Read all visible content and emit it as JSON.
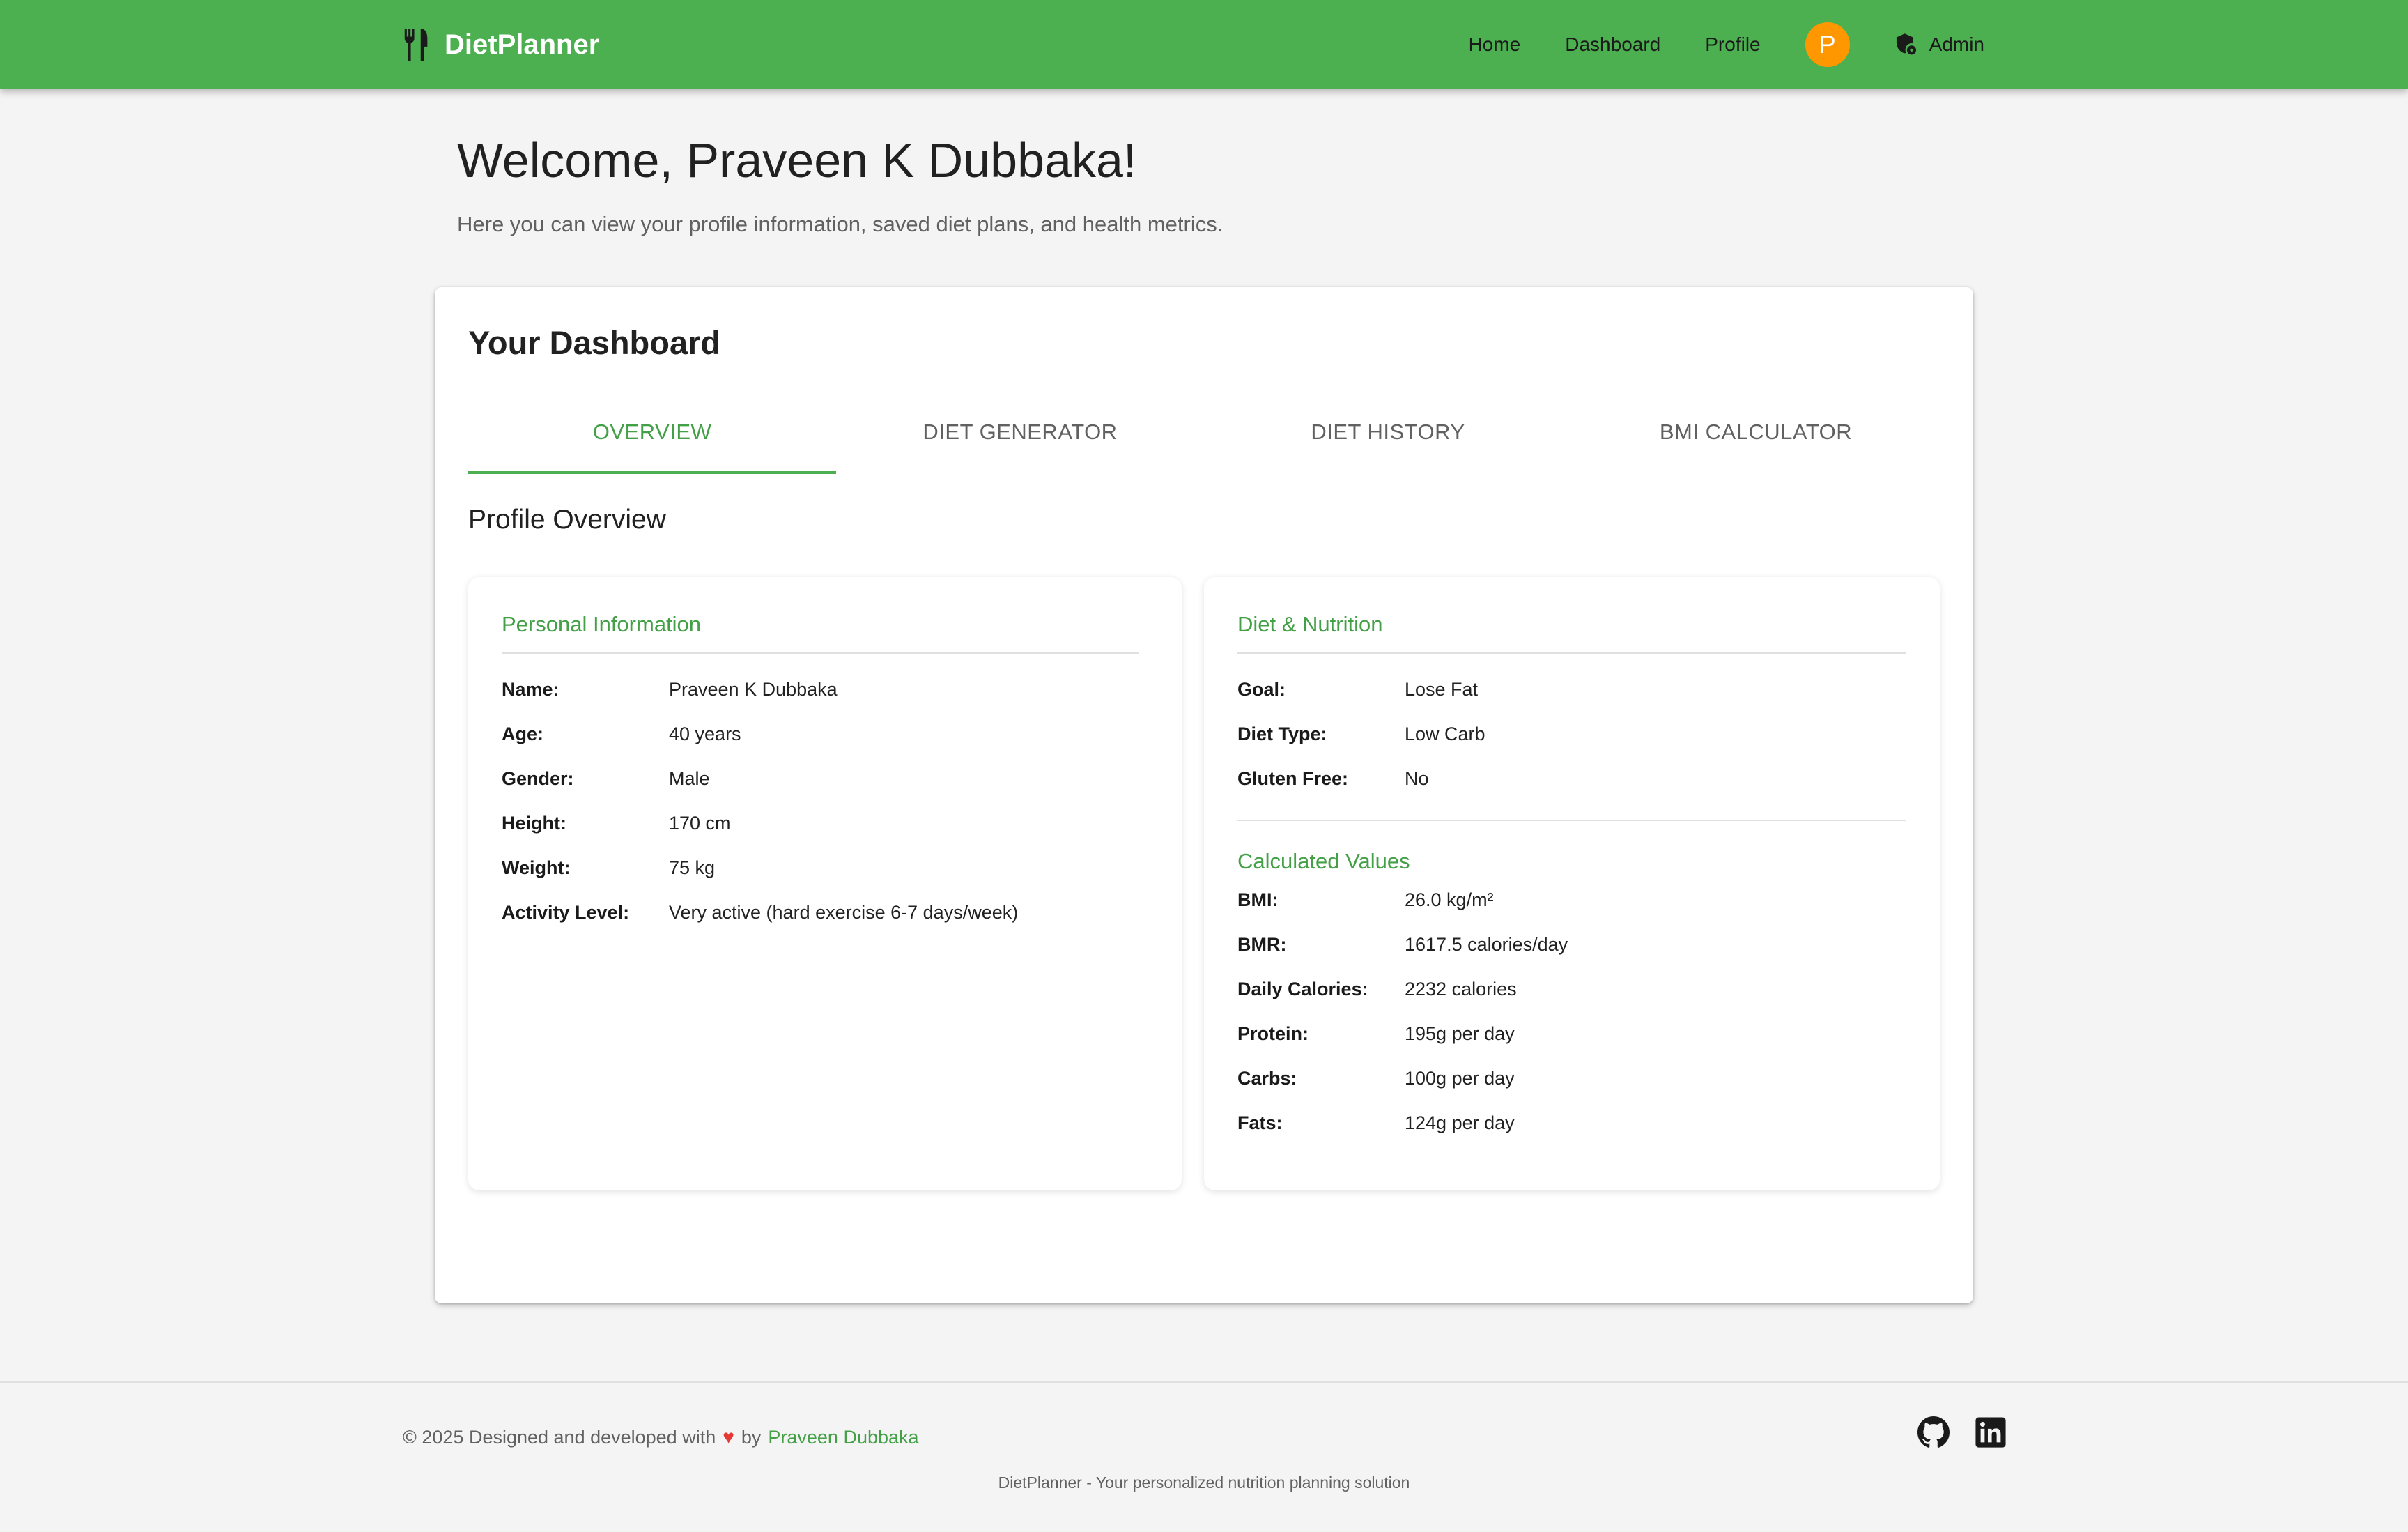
{
  "header": {
    "brand": "DietPlanner",
    "nav": [
      "Home",
      "Dashboard",
      "Profile"
    ],
    "avatar_initial": "P",
    "admin_label": "Admin",
    "accent_color": "#4caf50",
    "avatar_color": "#ff9800"
  },
  "welcome": {
    "title": "Welcome, Praveen K Dubbaka!",
    "subtitle": "Here you can view your profile information, saved diet plans, and health metrics."
  },
  "dashboard": {
    "title": "Your Dashboard",
    "tabs": [
      "OVERVIEW",
      "DIET GENERATOR",
      "DIET HISTORY",
      "BMI CALCULATOR"
    ],
    "active_tab": "OVERVIEW",
    "section_title": "Profile Overview",
    "personal": {
      "title": "Personal Information",
      "rows": [
        {
          "label": "Name:",
          "value": "Praveen K Dubbaka"
        },
        {
          "label": "Age:",
          "value": "40 years"
        },
        {
          "label": "Gender:",
          "value": "Male"
        },
        {
          "label": "Height:",
          "value": "170 cm"
        },
        {
          "label": "Weight:",
          "value": "75 kg"
        },
        {
          "label": "Activity Level:",
          "value": "Very active (hard exercise 6-7 days/week)"
        }
      ]
    },
    "diet": {
      "title": "Diet & Nutrition",
      "rows": [
        {
          "label": "Goal:",
          "value": "Lose Fat"
        },
        {
          "label": "Diet Type:",
          "value": "Low Carb"
        },
        {
          "label": "Gluten Free:",
          "value": "No"
        }
      ],
      "calculated_title": "Calculated Values",
      "calculated": [
        {
          "label": "BMI:",
          "value": "26.0 kg/m²"
        },
        {
          "label": "BMR:",
          "value": "1617.5 calories/day"
        },
        {
          "label": "Daily Calories:",
          "value": "2232 calories"
        },
        {
          "label": "Protein:",
          "value": "195g per day"
        },
        {
          "label": "Carbs:",
          "value": "100g per day"
        },
        {
          "label": "Fats:",
          "value": "124g per day"
        }
      ]
    }
  },
  "footer": {
    "copyright": "© 2025 Designed and developed with",
    "by": "by",
    "author": "Praveen Dubbaka",
    "tagline": "DietPlanner - Your personalized nutrition planning solution",
    "icons": [
      "github-icon",
      "linkedin-icon"
    ]
  }
}
